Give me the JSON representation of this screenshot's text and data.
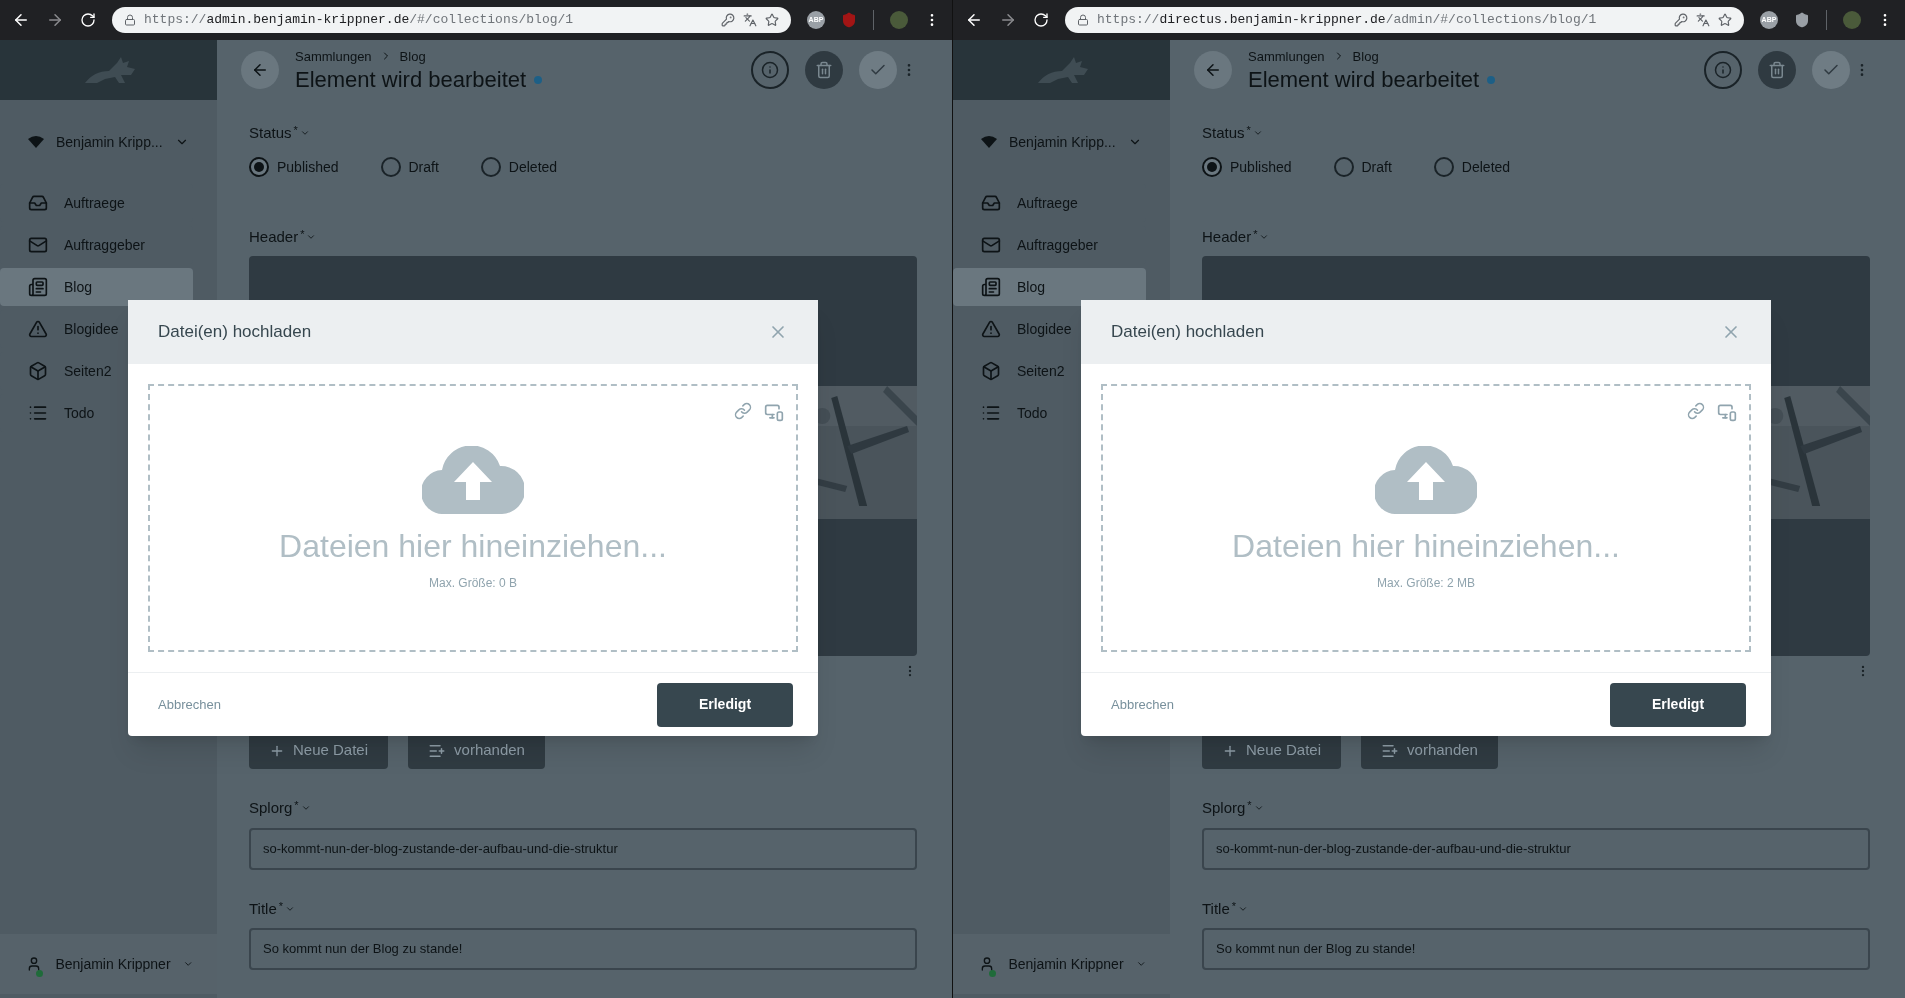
{
  "windows": [
    {
      "browser": {
        "url": [
          {
            "text": "https://",
            "strong": false
          },
          {
            "text": "admin.benjamin-krippner.de",
            "strong": true
          },
          {
            "text": "/#/collections/blog/1",
            "strong": false
          }
        ],
        "adblock_label": "ABP"
      },
      "sidebar": {
        "project": "Benjamin Kripp...",
        "items": [
          {
            "label": "Auftraege",
            "selected": false
          },
          {
            "label": "Auftraggeber",
            "selected": false
          },
          {
            "label": "Blog",
            "selected": true
          },
          {
            "label": "Blogidee",
            "selected": false
          },
          {
            "label": "Seiten2",
            "selected": false
          },
          {
            "label": "Todo",
            "selected": false
          }
        ],
        "user": "Benjamin Krippner"
      },
      "header": {
        "breadcrumb": [
          "Sammlungen",
          "Blog"
        ],
        "title": "Element wird bearbeitet"
      },
      "status": {
        "label": "Status",
        "required_mark": "*",
        "options": [
          {
            "label": "Published",
            "selected": true
          },
          {
            "label": "Draft",
            "selected": false
          },
          {
            "label": "Deleted",
            "selected": false
          }
        ]
      },
      "header_field": {
        "label": "Header",
        "required_mark": "*",
        "buttons": [
          "Neue Datei",
          "vorhanden"
        ]
      },
      "fields": [
        {
          "label": "Splorg",
          "required_mark": "*",
          "value": "so-kommt-nun-der-blog-zustande-der-aufbau-und-die-struktur"
        },
        {
          "label": "Title",
          "required_mark": "*",
          "value": "So kommt nun der Blog zu stande!"
        }
      ],
      "modal": {
        "title": "Datei(en) hochladen",
        "drop_text": "Dateien hier hineinziehen...",
        "max_size": "Max. Größe: 0 B",
        "cancel": "Abbrechen",
        "done": "Erledigt"
      }
    },
    {
      "browser": {
        "url": [
          {
            "text": "https://",
            "strong": false
          },
          {
            "text": "directus.benjamin-krippner.de",
            "strong": true
          },
          {
            "text": "/admin/#/collections/blog/1",
            "strong": false
          }
        ],
        "adblock_label": "ABP"
      },
      "sidebar": {
        "project": "Benjamin Kripp...",
        "items": [
          {
            "label": "Auftraege",
            "selected": false
          },
          {
            "label": "Auftraggeber",
            "selected": false
          },
          {
            "label": "Blog",
            "selected": true
          },
          {
            "label": "Blogidee",
            "selected": false
          },
          {
            "label": "Seiten2",
            "selected": false
          },
          {
            "label": "Todo",
            "selected": false
          }
        ],
        "user": "Benjamin Krippner"
      },
      "header": {
        "breadcrumb": [
          "Sammlungen",
          "Blog"
        ],
        "title": "Element wird bearbeitet"
      },
      "status": {
        "label": "Status",
        "required_mark": "*",
        "options": [
          {
            "label": "Published",
            "selected": true
          },
          {
            "label": "Draft",
            "selected": false
          },
          {
            "label": "Deleted",
            "selected": false
          }
        ]
      },
      "header_field": {
        "label": "Header",
        "required_mark": "*",
        "buttons": [
          "Neue Datei",
          "vorhanden"
        ]
      },
      "fields": [
        {
          "label": "Splorg",
          "required_mark": "*",
          "value": "so-kommt-nun-der-blog-zustande-der-aufbau-und-die-struktur"
        },
        {
          "label": "Title",
          "required_mark": "*",
          "value": "So kommt nun der Blog zu stande!"
        }
      ],
      "modal": {
        "title": "Datei(en) hochladen",
        "drop_text": "Dateien hier hineinziehen...",
        "max_size": "Max. Größe: 2 MB",
        "cancel": "Abbrechen",
        "done": "Erledigt"
      }
    }
  ]
}
